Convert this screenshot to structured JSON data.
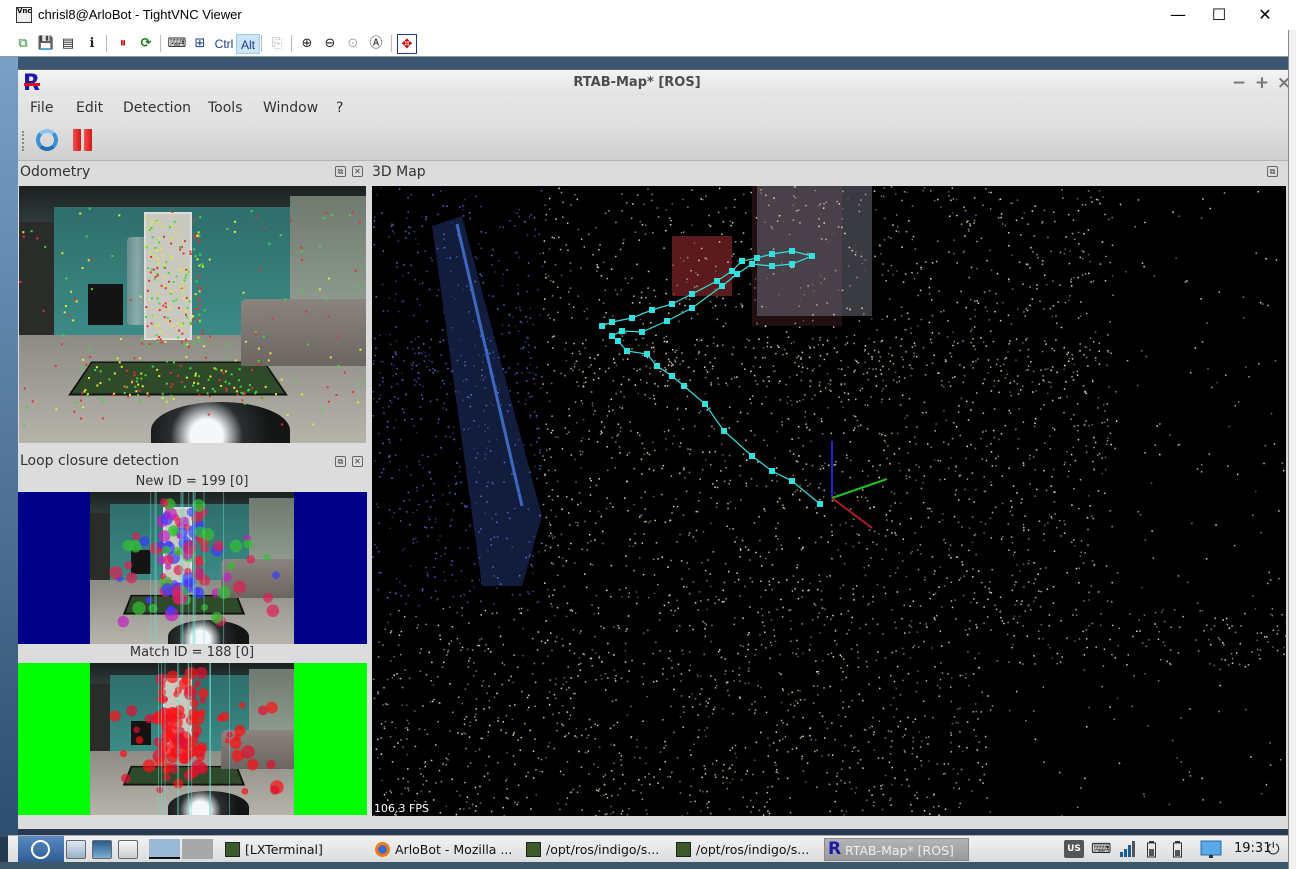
{
  "vnc": {
    "title": "chrisl8@ArloBot - TightVNC Viewer",
    "logo_text": "Vnc",
    "window_controls": {
      "minimize": "—",
      "maximize": "☐",
      "close": "✕"
    },
    "toolbar": [
      {
        "name": "new-connection",
        "glyph": "⧉"
      },
      {
        "name": "save",
        "glyph": "💾"
      },
      {
        "name": "options",
        "glyph": "▤"
      },
      {
        "name": "info",
        "glyph": "ℹ"
      },
      {
        "name": "pause",
        "glyph": "⏸"
      },
      {
        "name": "refresh",
        "glyph": "⟳"
      },
      {
        "name": "ctrl-alt-del",
        "glyph": "⌨"
      },
      {
        "name": "win-key",
        "glyph": "⊞"
      },
      {
        "name": "ctrl",
        "label": "Ctrl"
      },
      {
        "name": "alt",
        "label": "Alt"
      },
      {
        "name": "clipboard",
        "glyph": "⎘"
      },
      {
        "name": "zoom-in",
        "glyph": "⊕"
      },
      {
        "name": "zoom-out",
        "glyph": "⊖"
      },
      {
        "name": "zoom-100",
        "glyph": "⊙"
      },
      {
        "name": "zoom-auto",
        "glyph": "Ⓐ"
      },
      {
        "name": "fullscreen",
        "glyph": "✥"
      }
    ]
  },
  "app": {
    "logo": "R",
    "title": "RTAB-Map* [ROS]",
    "window_controls": {
      "minimize": "−",
      "maximize": "+",
      "close": "×"
    },
    "menu": [
      "File",
      "Edit",
      "Detection",
      "Tools",
      "Window",
      "?"
    ],
    "toolbar": [
      {
        "name": "reset-odometry",
        "icon": "refresh-icon"
      },
      {
        "name": "pause",
        "icon": "pause-icon"
      }
    ]
  },
  "panels": {
    "odometry": {
      "title": "Odometry"
    },
    "loop_closure": {
      "title": "Loop closure detection",
      "new_id_caption": "New ID = 199 [0]",
      "match_id_caption": "Match ID = 188 [0]",
      "new_bg_color": "#000088",
      "match_bg_color": "#00ff00"
    },
    "map3d": {
      "title": "3D Map",
      "fps": "106.3 FPS",
      "trajectory_color": "#33e0e0"
    }
  },
  "taskbar": {
    "tasks": [
      {
        "label": "[LXTerminal]",
        "icon": "terminal-icon"
      },
      {
        "label": "ArloBot - Mozilla ...",
        "icon": "firefox-icon"
      },
      {
        "label": "/opt/ros/indigo/s...",
        "icon": "terminal-icon"
      },
      {
        "label": "/opt/ros/indigo/s...",
        "icon": "terminal-icon"
      },
      {
        "label": "RTAB-Map* [ROS]",
        "icon": "rtabmap-icon",
        "active": true
      }
    ],
    "tray": {
      "keyboard_layout": "US",
      "clock": "19:31"
    }
  }
}
